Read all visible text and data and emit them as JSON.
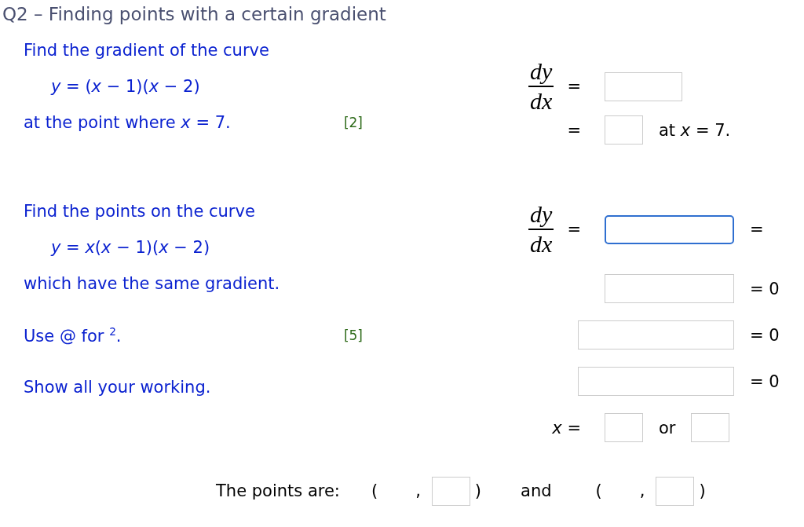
{
  "title": "Q2 – Finding points with a certain gradient",
  "parts": [
    {
      "paragraphs": [
        [
          {
            "kind": "text",
            "text": "Find the gradient of the curve"
          },
          {
            "kind": "equation",
            "text": "*y* = (*x* − 1)(*x* − 2)"
          },
          {
            "kind": "text",
            "text": "at the point where *x* = 7.",
            "marks": "[2]"
          }
        ]
      ],
      "rows": [
        {
          "lead": [
            {
              "kind": "fraction",
              "numerator": "dy",
              "denominator": "dx"
            },
            {
              "kind": "text",
              "text": "="
            }
          ],
          "body": [
            {
              "kind": "medium_field",
              "focused": false
            }
          ]
        },
        {
          "lead": [
            {
              "kind": "text",
              "text": "="
            }
          ],
          "body": [
            {
              "kind": "short_field",
              "focused": false
            },
            {
              "kind": "text",
              "text": "at *x* = 7."
            }
          ]
        }
      ]
    },
    {
      "paragraphs": [
        [
          {
            "kind": "text",
            "text": "Find the points on the curve"
          },
          {
            "kind": "equation",
            "text": "*y* = *x*(*x* − 1)(*x* − 2)"
          },
          {
            "kind": "text",
            "text": "which have the same gradient."
          }
        ],
        [
          {
            "kind": "text",
            "text": "Use @ for $^{2}$.",
            "marks": "[5]"
          }
        ],
        [
          {
            "kind": "text",
            "text": "Show all your working."
          }
        ]
      ],
      "rows": [
        {
          "lead": [
            {
              "kind": "fraction",
              "numerator": "dy",
              "denominator": "dx"
            },
            {
              "kind": "text",
              "text": "="
            }
          ],
          "body": [
            {
              "kind": "long_field",
              "focused": true
            },
            {
              "kind": "text",
              "text": "="
            }
          ]
        },
        {
          "lead": [],
          "body": [
            {
              "kind": "long_field",
              "focused": false
            },
            {
              "kind": "text",
              "text": "= 0"
            }
          ]
        },
        {
          "lead": [],
          "body": [
            {
              "kind": "wide_field",
              "focused": false
            },
            {
              "kind": "text",
              "text": "= 0"
            }
          ]
        },
        {
          "lead": [],
          "body": [
            {
              "kind": "wide_field",
              "focused": false
            },
            {
              "kind": "text",
              "text": "= 0"
            }
          ]
        },
        {
          "lead": [
            {
              "kind": "text",
              "text": "*x* ="
            }
          ],
          "body": [
            {
              "kind": "short_field",
              "focused": false
            },
            {
              "kind": "text",
              "text": "or"
            },
            {
              "kind": "short_field",
              "focused": false
            }
          ]
        }
      ]
    }
  ],
  "answer": {
    "label": "The points are:",
    "joiner": "and",
    "points": [
      {
        "open": "(",
        "separator": ",",
        "close": ")",
        "field": {
          "focused": false
        }
      },
      {
        "open": "(",
        "separator": ",",
        "close": ")",
        "field": {
          "focused": false
        }
      }
    ]
  }
}
